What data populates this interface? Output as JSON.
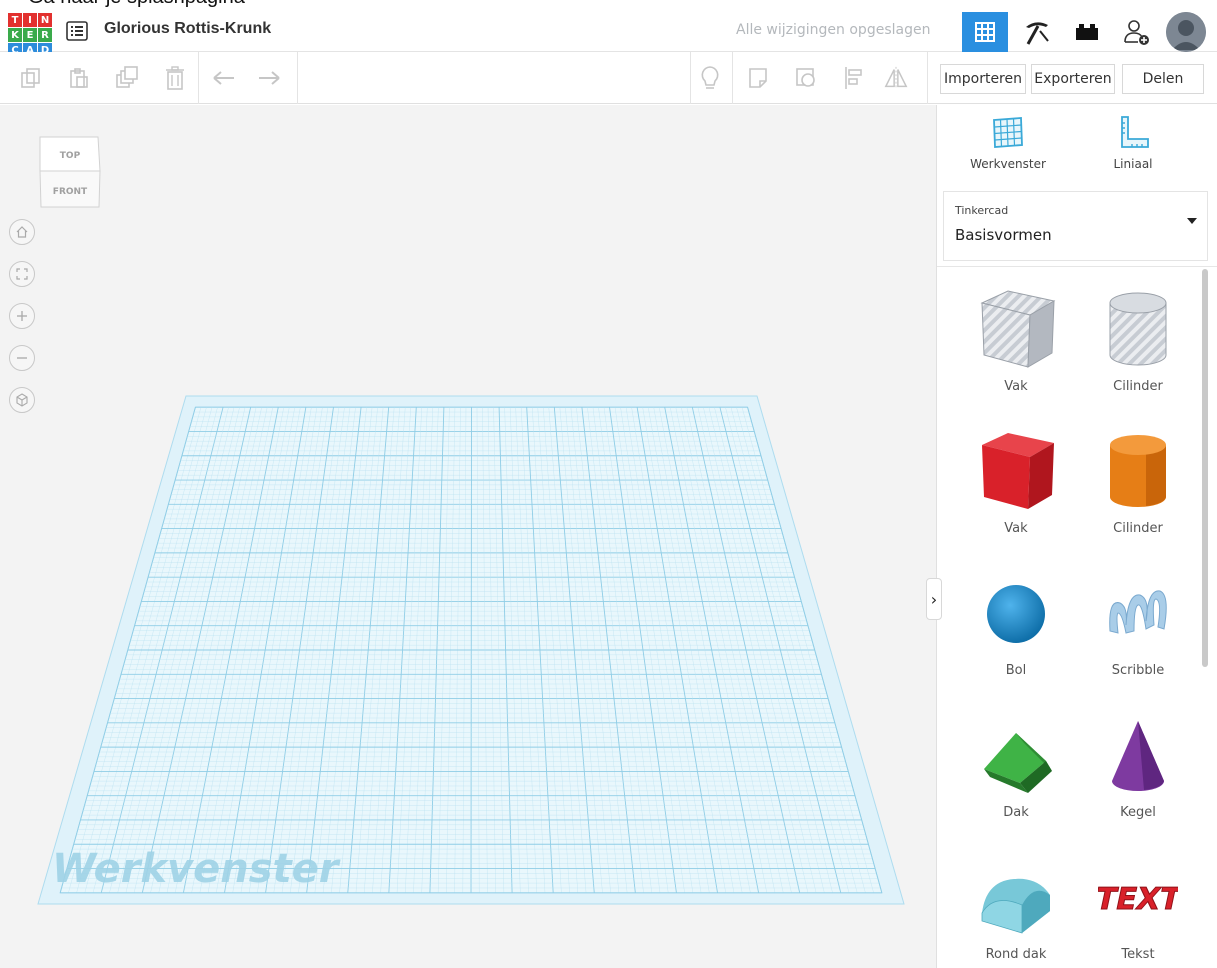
{
  "caption": "Ga naar je splashpagina",
  "header": {
    "logo_letters": [
      "T",
      "I",
      "N",
      "K",
      "E",
      "R",
      "C",
      "A",
      "D"
    ],
    "logo_colors": [
      "#e2312f",
      "#e2312f",
      "#e2312f",
      "#3aaa4b",
      "#3aaa4b",
      "#3aaa4b",
      "#2d8cdb",
      "#2d8cdb",
      "#2d8cdb"
    ],
    "design_title": "Glorious Rottis-Krunk",
    "save_status": "Alle wijzigingen opgeslagen",
    "accent": "#2a8fe0"
  },
  "toolbar": {
    "import_label": "Importeren",
    "export_label": "Exporteren",
    "share_label": "Delen",
    "icons": [
      "copy-icon",
      "paste-icon",
      "duplicate-icon",
      "delete-icon",
      "undo-icon",
      "redo-icon",
      "lightbulb-icon",
      "note-icon",
      "hide-icon",
      "align-icon",
      "mirror-icon"
    ]
  },
  "viewcube": {
    "top_label": "TOP",
    "front_label": "FRONT"
  },
  "nav_buttons": [
    "home-icon",
    "fit-view-icon",
    "zoom-in-icon",
    "zoom-out-icon",
    "perspective-icon"
  ],
  "workplane": {
    "watermark": "Werkvenster",
    "color": "#aedcef"
  },
  "panel": {
    "tools": [
      {
        "label": "Werkvenster",
        "icon": "workplane-icon"
      },
      {
        "label": "Liniaal",
        "icon": "ruler-icon"
      }
    ],
    "library": {
      "source": "Tinkercad",
      "selected": "Basisvormen"
    },
    "shapes": [
      {
        "label": "Vak",
        "icon": "box-hole-icon",
        "color": "#b7bcc4"
      },
      {
        "label": "Cilinder",
        "icon": "cylinder-hole-icon",
        "color": "#b7bcc4"
      },
      {
        "label": "Vak",
        "icon": "box-icon",
        "color": "#d9212a"
      },
      {
        "label": "Cilinder",
        "icon": "cylinder-icon",
        "color": "#e67e16"
      },
      {
        "label": "Bol",
        "icon": "sphere-icon",
        "color": "#1e8fd0"
      },
      {
        "label": "Scribble",
        "icon": "scribble-icon",
        "color": "#a9cde8"
      },
      {
        "label": "Dak",
        "icon": "roof-icon",
        "color": "#35a73a"
      },
      {
        "label": "Kegel",
        "icon": "cone-icon",
        "color": "#7e3aa0"
      },
      {
        "label": "Rond dak",
        "icon": "round-roof-icon",
        "color": "#78c8d8"
      },
      {
        "label": "Tekst",
        "icon": "text-shape-icon",
        "color": "#d9212a"
      }
    ],
    "text_shape_word": "TEXT"
  }
}
